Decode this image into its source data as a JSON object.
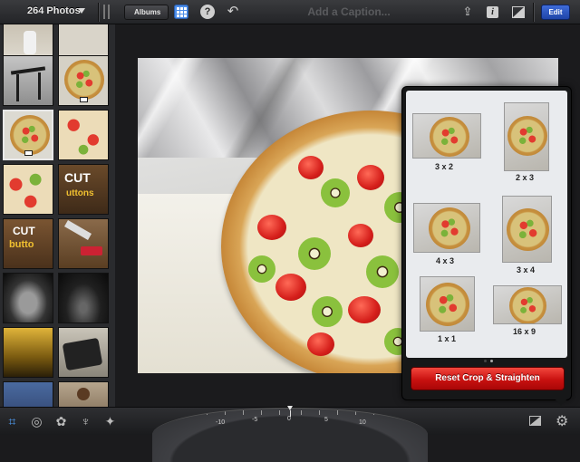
{
  "topbar": {
    "photos_count": "264 Photos",
    "albums_label": "Albums",
    "caption_placeholder": "Add a Caption...",
    "edit_label": "Edit",
    "help_glyph": "?",
    "info_glyph": "i",
    "undo_glyph": "↶",
    "share_glyph": "⇪"
  },
  "sidebar": {
    "thumbs": [
      {
        "kind": "person"
      },
      {
        "kind": "blank"
      },
      {
        "kind": "chair"
      },
      {
        "kind": "tart"
      },
      {
        "kind": "tart",
        "selected": true
      },
      {
        "kind": "tart-closeup"
      },
      {
        "kind": "tart-closeup"
      },
      {
        "kind": "cut-the-buttons"
      },
      {
        "kind": "cut-the-buttons"
      },
      {
        "kind": "game"
      },
      {
        "kind": "dark-face"
      },
      {
        "kind": "dark"
      },
      {
        "kind": "yellow"
      },
      {
        "kind": "phone"
      },
      {
        "kind": "screen"
      },
      {
        "kind": "person"
      }
    ],
    "thumb_text_1": "CUT",
    "thumb_text_2": "uttons",
    "thumb_text_3": "CUT",
    "thumb_text_4": "butto"
  },
  "crop_panel": {
    "options": [
      {
        "label": "3 x 2"
      },
      {
        "label": "2 x 3"
      },
      {
        "label": "4 x 3"
      },
      {
        "label": "3 x 4"
      },
      {
        "label": "1 x 1"
      },
      {
        "label": "16 x 9"
      }
    ],
    "reset_label": "Reset Crop & Straighten",
    "page_dots": 2
  },
  "bottombar": {
    "dial_labels": [
      "-10",
      "-5",
      "0",
      "5",
      "10"
    ],
    "tools": [
      {
        "icon": "crop-icon",
        "glyph": "⌗",
        "active": true
      },
      {
        "icon": "exposure-icon",
        "glyph": "◎"
      },
      {
        "icon": "color-icon",
        "glyph": "✿"
      },
      {
        "icon": "brushes-icon",
        "glyph": "♆"
      },
      {
        "icon": "effects-icon",
        "glyph": "✦"
      }
    ]
  },
  "colors": {
    "accent_blue": "#4c8de8",
    "reset_red": "#c91110",
    "edit_blue": "#1f44a8"
  }
}
